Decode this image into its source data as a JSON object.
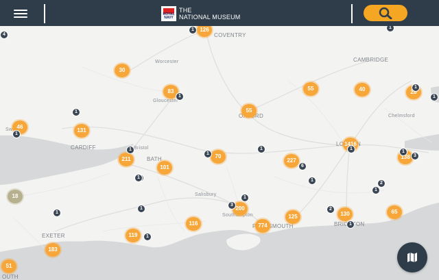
{
  "header": {
    "brand_line1": "THE",
    "brand_line2": "NATIONAL MUSEUM",
    "logo_text": "ROYAL NAVY"
  },
  "places": {
    "coventry": "COVENTRY",
    "cambridge": "CAMBRIDGE",
    "worcester": "Worcester",
    "gloucester": "Gloucester",
    "oxford": "OXFORD",
    "chelmsford": "Chelmsford",
    "cardiff": "CARDIFF",
    "bath": "BATH",
    "london": "LONDON",
    "salisbury": "Salisbury",
    "southampton": "Southampton",
    "portsmouth": "PORTSMOUTH",
    "brighton": "BRIGHTON",
    "exeter": "EXETER",
    "bristol": "Bristol",
    "swansea": "Sw",
    "plymouth": "OUTH"
  },
  "clusters": [
    "126",
    "30",
    "83",
    "55",
    "55",
    "40",
    "28",
    "46",
    "131",
    "1416",
    "211",
    "101",
    "70",
    "227",
    "138",
    "18",
    "200",
    "774",
    "125",
    "130",
    "65",
    "116",
    "119",
    "183",
    "51"
  ],
  "pins": [
    "4",
    "1",
    "1",
    "1",
    "1",
    "1",
    "1",
    "1",
    "1",
    "3",
    "1",
    "1",
    "1",
    "6",
    "1",
    "1",
    "2",
    "3",
    "1",
    "1",
    "3",
    "2",
    "1",
    "1",
    "1",
    "1",
    "1",
    "1",
    "1"
  ],
  "colors": {
    "header": "#2f3d4a",
    "accent": "#f5a623",
    "cluster": "#f7a73a",
    "pin": "#3b4654",
    "sea": "#d6d8d9"
  },
  "icons": {
    "menu": "hamburger-icon",
    "search": "search-icon",
    "map": "map-icon",
    "pin": "anchor-pin-icon"
  }
}
